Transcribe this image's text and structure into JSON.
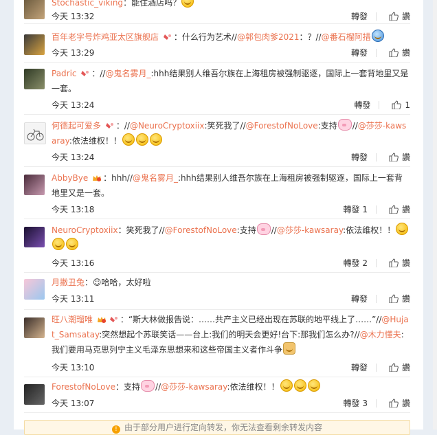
{
  "comments": [
    {
      "user": "Stochastic_viking",
      "text": "：能住酒店吗？",
      "time": "今天 13:32",
      "repost": "轉發",
      "likes": "",
      "like_label": "讚"
    },
    {
      "user": "百年老字号炸鸡亚太区旗舰店",
      "text": "：什么行为艺术//",
      "m1": "@郭包肉爹2021",
      "t2": "：？//",
      "m2": "@番石榴阿措",
      "time": "今天 13:29",
      "repost": "轉發",
      "likes": "",
      "like_label": "讚"
    },
    {
      "user": "Padric",
      "text": "：//",
      "m1": "@鬼名雾月_",
      "t2": ":hhh结果别人维吾尔族在上海租房被强制驱逐，国际上一套背地里又是一套。",
      "time": "今天 13:24",
      "repost": "轉發",
      "likes": "1",
      "like_label": ""
    },
    {
      "user": "何德起可爱多",
      "text": "：//",
      "m1": "@NeuroCryptoxiix",
      "t2": ":笑死我了//",
      "m2": "@ForestofNoLove",
      "t3": ":支持",
      "t4": "//",
      "m3": "@莎莎-kawsaray",
      "t5": ":依法维权！！",
      "time": "今天 13:24",
      "repost": "轉發",
      "likes": "",
      "like_label": "讚"
    },
    {
      "user": "AbbyBye",
      "text": "：hhh//",
      "m1": "@鬼名雾月_",
      "t2": ":hhh结果别人维吾尔族在上海租房被强制驱逐，国际上一套背地里又是一套。",
      "time": "今天 13:18",
      "repost": "轉發 1",
      "likes": "",
      "like_label": "讚"
    },
    {
      "user": "NeuroCryptoxiix",
      "text": "：笑死我了//",
      "m1": "@ForestofNoLove",
      "t2": ":支持",
      "t3": "//",
      "m2": "@莎莎-kawsaray",
      "t4": ":依法维权！！",
      "time": "今天 13:16",
      "repost": "轉發 2",
      "likes": "",
      "like_label": "讚"
    },
    {
      "user": "月撇丑兔",
      "text": "：☺哈哈，太好啦",
      "time": "今天 13:11",
      "repost": "轉發",
      "likes": "",
      "like_label": "讚"
    },
    {
      "user": "旺八潮瑠唯",
      "text": "：“斯大林做报告说：……共产主义已经出现在苏联的地平线上了……”//",
      "m1": "@Hujat_Samsatay",
      "t2": ":突然想起个苏联笑话——台上:我们的明天会更好!台下:那我们怎么办?//",
      "m2": "@木力懂夫",
      "t3": ":我们要用马克思列宁主义毛泽东思想来和这些帝国主义者作斗争",
      "time": "今天 13:10",
      "repost": "轉發",
      "likes": "",
      "like_label": "讚"
    },
    {
      "user": "ForestofNoLove",
      "text": "：支持",
      "t2": "//",
      "m1": "@莎莎-kawsaray",
      "t3": ":依法维权！！",
      "time": "今天 13:07",
      "repost": "轉發 3",
      "likes": "",
      "like_label": "讚"
    }
  ],
  "notice": "由于部分用户进行定向转发，你无法查看剩余转发内容",
  "colors": {
    "link": "#eb7350",
    "background": "#e9eef4"
  }
}
